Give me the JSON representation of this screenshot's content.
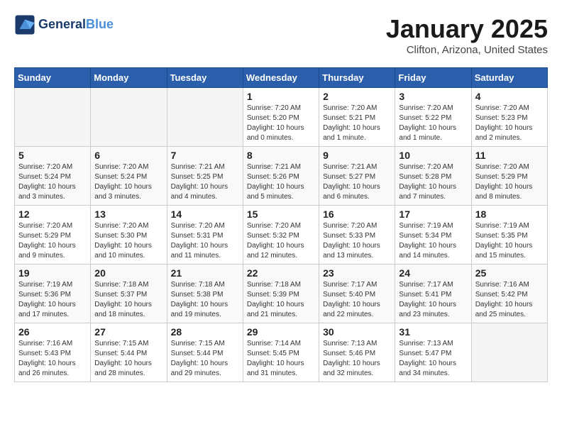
{
  "header": {
    "logo_line1": "General",
    "logo_line2": "Blue",
    "month": "January 2025",
    "location": "Clifton, Arizona, United States"
  },
  "days_of_week": [
    "Sunday",
    "Monday",
    "Tuesday",
    "Wednesday",
    "Thursday",
    "Friday",
    "Saturday"
  ],
  "weeks": [
    [
      {
        "day": "",
        "info": ""
      },
      {
        "day": "",
        "info": ""
      },
      {
        "day": "",
        "info": ""
      },
      {
        "day": "1",
        "info": "Sunrise: 7:20 AM\nSunset: 5:20 PM\nDaylight: 10 hours\nand 0 minutes."
      },
      {
        "day": "2",
        "info": "Sunrise: 7:20 AM\nSunset: 5:21 PM\nDaylight: 10 hours\nand 1 minute."
      },
      {
        "day": "3",
        "info": "Sunrise: 7:20 AM\nSunset: 5:22 PM\nDaylight: 10 hours\nand 1 minute."
      },
      {
        "day": "4",
        "info": "Sunrise: 7:20 AM\nSunset: 5:23 PM\nDaylight: 10 hours\nand 2 minutes."
      }
    ],
    [
      {
        "day": "5",
        "info": "Sunrise: 7:20 AM\nSunset: 5:24 PM\nDaylight: 10 hours\nand 3 minutes."
      },
      {
        "day": "6",
        "info": "Sunrise: 7:20 AM\nSunset: 5:24 PM\nDaylight: 10 hours\nand 3 minutes."
      },
      {
        "day": "7",
        "info": "Sunrise: 7:21 AM\nSunset: 5:25 PM\nDaylight: 10 hours\nand 4 minutes."
      },
      {
        "day": "8",
        "info": "Sunrise: 7:21 AM\nSunset: 5:26 PM\nDaylight: 10 hours\nand 5 minutes."
      },
      {
        "day": "9",
        "info": "Sunrise: 7:21 AM\nSunset: 5:27 PM\nDaylight: 10 hours\nand 6 minutes."
      },
      {
        "day": "10",
        "info": "Sunrise: 7:20 AM\nSunset: 5:28 PM\nDaylight: 10 hours\nand 7 minutes."
      },
      {
        "day": "11",
        "info": "Sunrise: 7:20 AM\nSunset: 5:29 PM\nDaylight: 10 hours\nand 8 minutes."
      }
    ],
    [
      {
        "day": "12",
        "info": "Sunrise: 7:20 AM\nSunset: 5:29 PM\nDaylight: 10 hours\nand 9 minutes."
      },
      {
        "day": "13",
        "info": "Sunrise: 7:20 AM\nSunset: 5:30 PM\nDaylight: 10 hours\nand 10 minutes."
      },
      {
        "day": "14",
        "info": "Sunrise: 7:20 AM\nSunset: 5:31 PM\nDaylight: 10 hours\nand 11 minutes."
      },
      {
        "day": "15",
        "info": "Sunrise: 7:20 AM\nSunset: 5:32 PM\nDaylight: 10 hours\nand 12 minutes."
      },
      {
        "day": "16",
        "info": "Sunrise: 7:20 AM\nSunset: 5:33 PM\nDaylight: 10 hours\nand 13 minutes."
      },
      {
        "day": "17",
        "info": "Sunrise: 7:19 AM\nSunset: 5:34 PM\nDaylight: 10 hours\nand 14 minutes."
      },
      {
        "day": "18",
        "info": "Sunrise: 7:19 AM\nSunset: 5:35 PM\nDaylight: 10 hours\nand 15 minutes."
      }
    ],
    [
      {
        "day": "19",
        "info": "Sunrise: 7:19 AM\nSunset: 5:36 PM\nDaylight: 10 hours\nand 17 minutes."
      },
      {
        "day": "20",
        "info": "Sunrise: 7:18 AM\nSunset: 5:37 PM\nDaylight: 10 hours\nand 18 minutes."
      },
      {
        "day": "21",
        "info": "Sunrise: 7:18 AM\nSunset: 5:38 PM\nDaylight: 10 hours\nand 19 minutes."
      },
      {
        "day": "22",
        "info": "Sunrise: 7:18 AM\nSunset: 5:39 PM\nDaylight: 10 hours\nand 21 minutes."
      },
      {
        "day": "23",
        "info": "Sunrise: 7:17 AM\nSunset: 5:40 PM\nDaylight: 10 hours\nand 22 minutes."
      },
      {
        "day": "24",
        "info": "Sunrise: 7:17 AM\nSunset: 5:41 PM\nDaylight: 10 hours\nand 23 minutes."
      },
      {
        "day": "25",
        "info": "Sunrise: 7:16 AM\nSunset: 5:42 PM\nDaylight: 10 hours\nand 25 minutes."
      }
    ],
    [
      {
        "day": "26",
        "info": "Sunrise: 7:16 AM\nSunset: 5:43 PM\nDaylight: 10 hours\nand 26 minutes."
      },
      {
        "day": "27",
        "info": "Sunrise: 7:15 AM\nSunset: 5:44 PM\nDaylight: 10 hours\nand 28 minutes."
      },
      {
        "day": "28",
        "info": "Sunrise: 7:15 AM\nSunset: 5:44 PM\nDaylight: 10 hours\nand 29 minutes."
      },
      {
        "day": "29",
        "info": "Sunrise: 7:14 AM\nSunset: 5:45 PM\nDaylight: 10 hours\nand 31 minutes."
      },
      {
        "day": "30",
        "info": "Sunrise: 7:13 AM\nSunset: 5:46 PM\nDaylight: 10 hours\nand 32 minutes."
      },
      {
        "day": "31",
        "info": "Sunrise: 7:13 AM\nSunset: 5:47 PM\nDaylight: 10 hours\nand 34 minutes."
      },
      {
        "day": "",
        "info": ""
      }
    ]
  ]
}
